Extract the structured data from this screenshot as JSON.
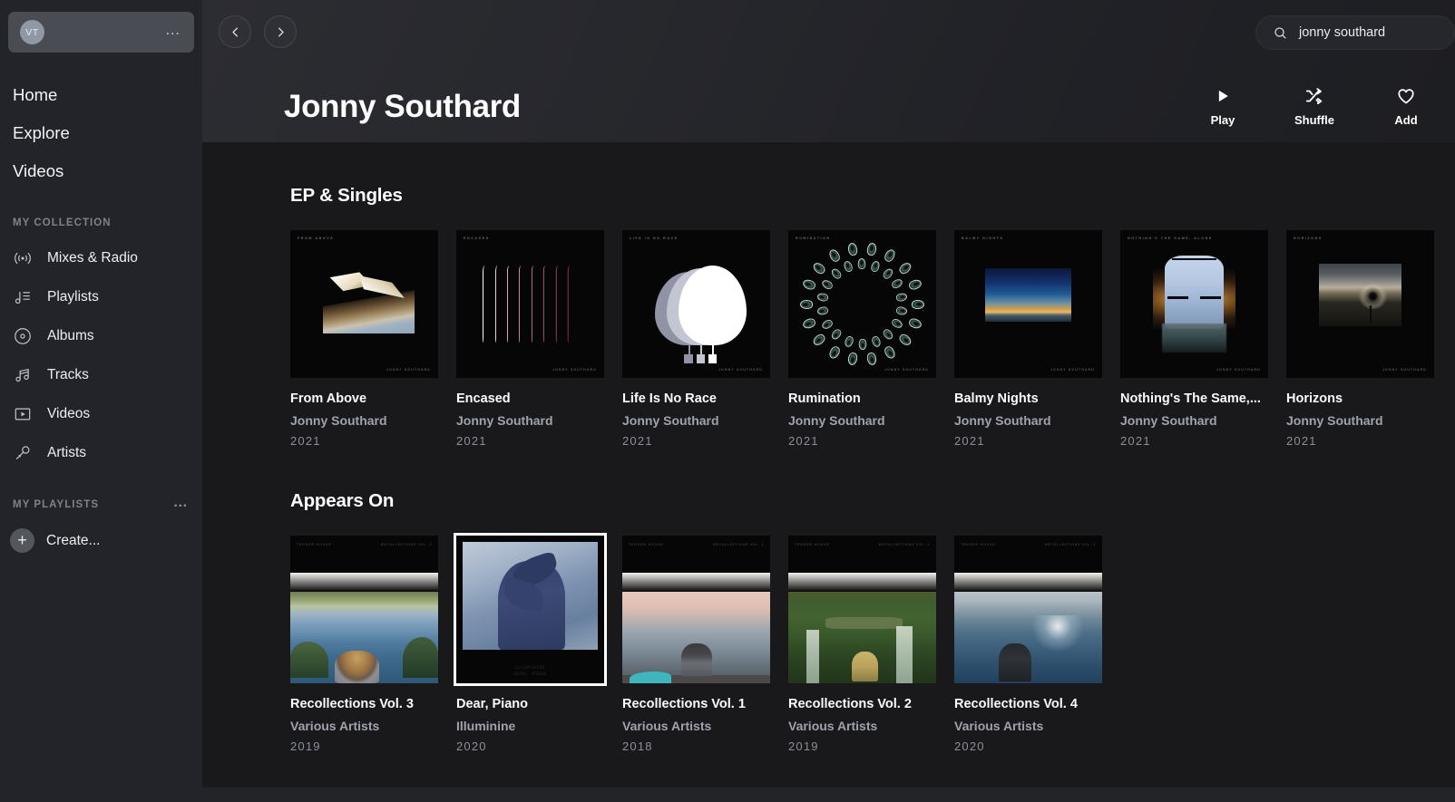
{
  "sidebar": {
    "user": {
      "initials": "VT",
      "menu_icon": "ellipsis-icon"
    },
    "top_nav": [
      {
        "label": "Home"
      },
      {
        "label": "Explore"
      },
      {
        "label": "Videos"
      }
    ],
    "collection_label": "MY COLLECTION",
    "collection": [
      {
        "label": "Mixes & Radio",
        "icon": "radio-icon"
      },
      {
        "label": "Playlists",
        "icon": "playlist-icon"
      },
      {
        "label": "Albums",
        "icon": "disc-icon"
      },
      {
        "label": "Tracks",
        "icon": "music-note-icon"
      },
      {
        "label": "Videos",
        "icon": "video-icon"
      },
      {
        "label": "Artists",
        "icon": "microphone-icon"
      }
    ],
    "playlists_label": "MY PLAYLISTS",
    "create_label": "Create..."
  },
  "header": {
    "back_icon": "chevron-left-icon",
    "forward_icon": "chevron-right-icon",
    "title": "Jonny Southard",
    "search": {
      "value": "jonny southard",
      "icon": "search-icon"
    },
    "actions": [
      {
        "label": "Play",
        "icon": "play-icon"
      },
      {
        "label": "Shuffle",
        "icon": "shuffle-icon"
      },
      {
        "label": "Add",
        "icon": "heart-icon"
      }
    ]
  },
  "sections": [
    {
      "title": "EP & Singles",
      "items": [
        {
          "title": "From Above",
          "artist": "Jonny Southard",
          "year": "2021",
          "cover_title": "FROM ABOVE",
          "cover_credit": "JONNY SOUTHARD"
        },
        {
          "title": "Encased",
          "artist": "Jonny Southard",
          "year": "2021",
          "cover_title": "ENCASED",
          "cover_credit": "JONNY SOUTHARD"
        },
        {
          "title": "Life Is No Race",
          "artist": "Jonny Southard",
          "year": "2021",
          "cover_title": "LIFE IS NO RACE",
          "cover_credit": "JONNY SOUTHARD"
        },
        {
          "title": "Rumination",
          "artist": "Jonny Southard",
          "year": "2021",
          "cover_title": "RUMINATION",
          "cover_credit": "JONNY SOUTHARD"
        },
        {
          "title": "Balmy Nights",
          "artist": "Jonny Southard",
          "year": "2021",
          "cover_title": "BALMY NIGHTS",
          "cover_credit": "JONNY SOUTHARD"
        },
        {
          "title": "Nothing's The Same,...",
          "artist": "Jonny Southard",
          "year": "2021",
          "cover_title": "NOTHING'S THE SAME, ALONE",
          "cover_credit": "JONNY SOUTHARD"
        },
        {
          "title": "Horizons",
          "artist": "Jonny Southard",
          "year": "2021",
          "cover_title": "HORIZONS",
          "cover_credit": "JONNY SOUTHARD"
        }
      ]
    },
    {
      "title": "Appears On",
      "items": [
        {
          "title": "Recollections Vol. 3",
          "artist": "Various Artists",
          "year": "2019",
          "cover_label_left": "TENDER HOUSE",
          "cover_label_right": "RECOLLECTIONS VOL. 3"
        },
        {
          "title": "Dear, Piano",
          "artist": "Illuminine",
          "year": "2020",
          "cover_caption_line1": "ILLUMININE",
          "cover_caption_line2": "DEAR, PIANO",
          "selected": true
        },
        {
          "title": "Recollections Vol. 1",
          "artist": "Various Artists",
          "year": "2018",
          "cover_label_left": "TENDER HOUSE",
          "cover_label_right": "RECOLLECTIONS VOL. 1"
        },
        {
          "title": "Recollections Vol. 2",
          "artist": "Various Artists",
          "year": "2019",
          "cover_label_left": "TENDER HOUSE",
          "cover_label_right": "RECOLLECTIONS VOL. 2"
        },
        {
          "title": "Recollections Vol. 4",
          "artist": "Various Artists",
          "year": "2020",
          "cover_label_left": "TENDER HOUSE",
          "cover_label_right": "RECOLLECTIONS VOL. 4"
        }
      ]
    }
  ],
  "colors": {
    "sidebar_bg": "#232429",
    "main_bg": "#19191c",
    "accent_text": "#ffffff",
    "muted_text": "#9fa3ac",
    "section_label": "#7e828d"
  }
}
